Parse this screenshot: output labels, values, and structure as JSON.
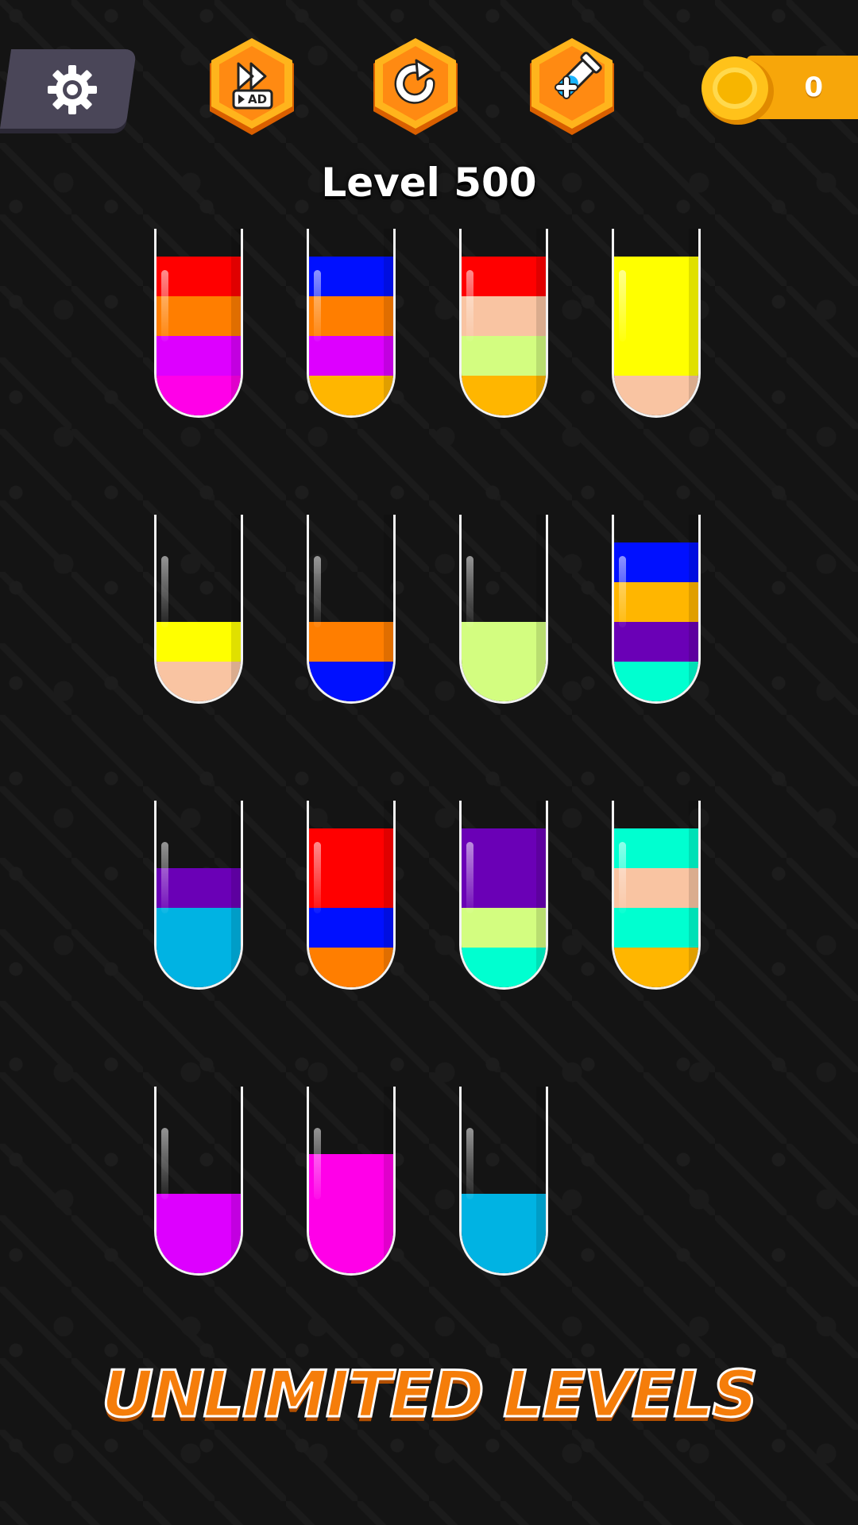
{
  "header": {
    "settings_icon": "gear-icon",
    "skip_ad_icon": "skip-ad-icon",
    "skip_ad_label": "AD",
    "restart_icon": "restart-icon",
    "add_tube_icon": "add-tube-icon",
    "coin_icon": "coin-icon",
    "coins": "0"
  },
  "level": {
    "title": "Level 500"
  },
  "colors": {
    "red": "#ff0000",
    "orange": "#ff7e00",
    "magenta": "#dd00ff",
    "pink": "#ff00e8",
    "blue": "#0010ff",
    "amber": "#ffb600",
    "peach": "#f9c4a2",
    "lime": "#d3fd80",
    "yellow": "#ffff00",
    "purple": "#6a00b6",
    "teal": "#00ffd0",
    "sky": "#00b3e3"
  },
  "tubes": [
    {
      "layers": [
        "pink",
        "magenta",
        "orange",
        "red"
      ]
    },
    {
      "layers": [
        "amber",
        "magenta",
        "orange",
        "blue"
      ]
    },
    {
      "layers": [
        "amber",
        "lime",
        "peach",
        "red"
      ]
    },
    {
      "layers": [
        "peach",
        "yellow",
        "yellow",
        "yellow"
      ]
    },
    {
      "layers": [
        "peach",
        "yellow"
      ]
    },
    {
      "layers": [
        "blue",
        "orange"
      ]
    },
    {
      "layers": [
        "lime",
        "lime"
      ]
    },
    {
      "layers": [
        "teal",
        "purple",
        "amber",
        "blue"
      ]
    },
    {
      "layers": [
        "sky",
        "sky",
        "purple"
      ]
    },
    {
      "layers": [
        "orange",
        "blue",
        "red",
        "red"
      ]
    },
    {
      "layers": [
        "teal",
        "lime",
        "purple",
        "purple"
      ]
    },
    {
      "layers": [
        "amber",
        "teal",
        "peach",
        "teal"
      ]
    },
    {
      "layers": [
        "magenta",
        "magenta"
      ]
    },
    {
      "layers": [
        "pink",
        "pink",
        "pink"
      ]
    },
    {
      "layers": [
        "sky",
        "sky"
      ]
    }
  ],
  "banner": {
    "text": "UNLIMITED LEVELS"
  }
}
